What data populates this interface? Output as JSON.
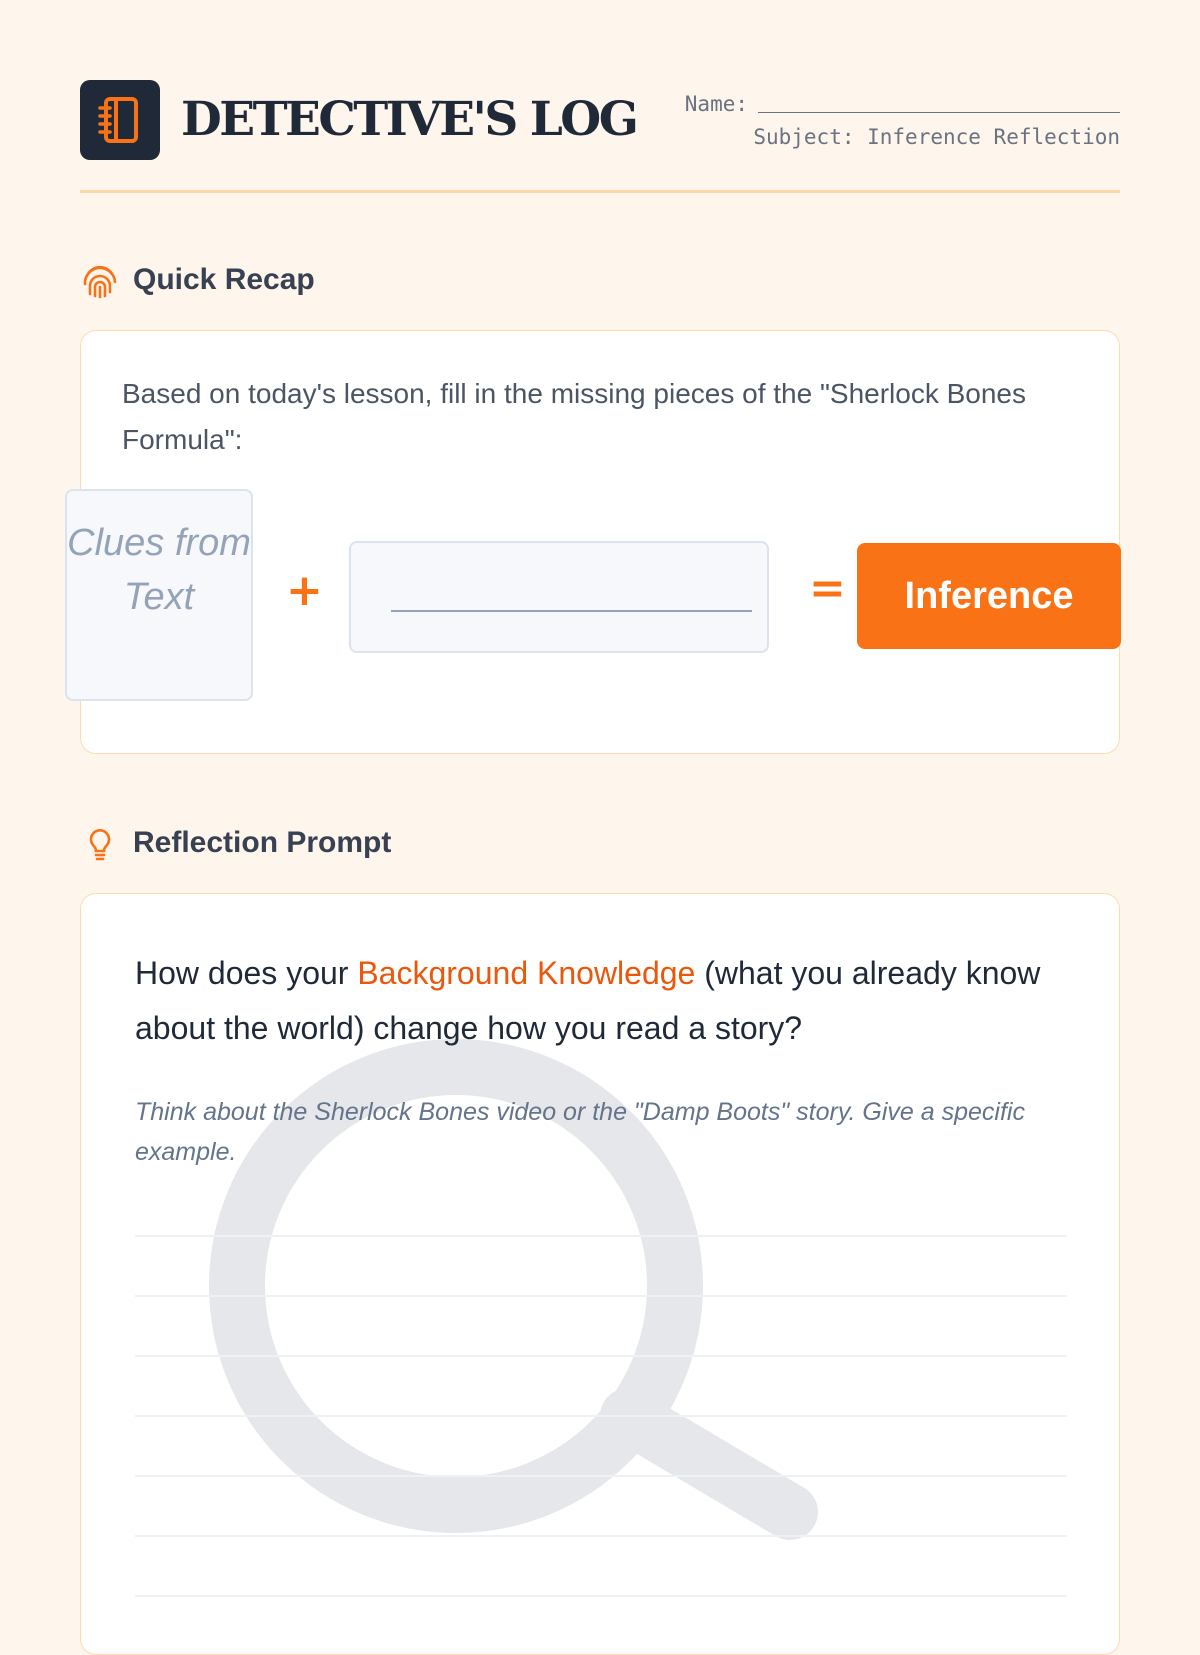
{
  "header": {
    "title": "DETECTIVE'S LOG",
    "name_label": "Name:",
    "subject_label": "Subject: Inference Reflection",
    "logo_icon": "notebook-icon"
  },
  "recap": {
    "heading": "Quick Recap",
    "heading_icon": "fingerprint-icon",
    "instruction": "Based on today's lesson, fill in the missing pieces of the \"Sherlock Bones Formula\":",
    "clue_text": "Clues from Text",
    "plus": "+",
    "equals": "=",
    "result": "Inference"
  },
  "reflection": {
    "heading": "Reflection Prompt",
    "heading_icon": "lightbulb-icon",
    "question_pre": "How does your ",
    "question_highlight": "Background Knowledge",
    "question_post": " (what you already know about the world) change how you read a story?",
    "hint": "Think about the Sherlock Bones video or the \"Damp Boots\" story. Give a specific example.",
    "watermark_icon": "magnifying-glass-icon"
  },
  "colors": {
    "accent": "#f97316",
    "background": "#fef5ec",
    "dark": "#1f2937"
  }
}
